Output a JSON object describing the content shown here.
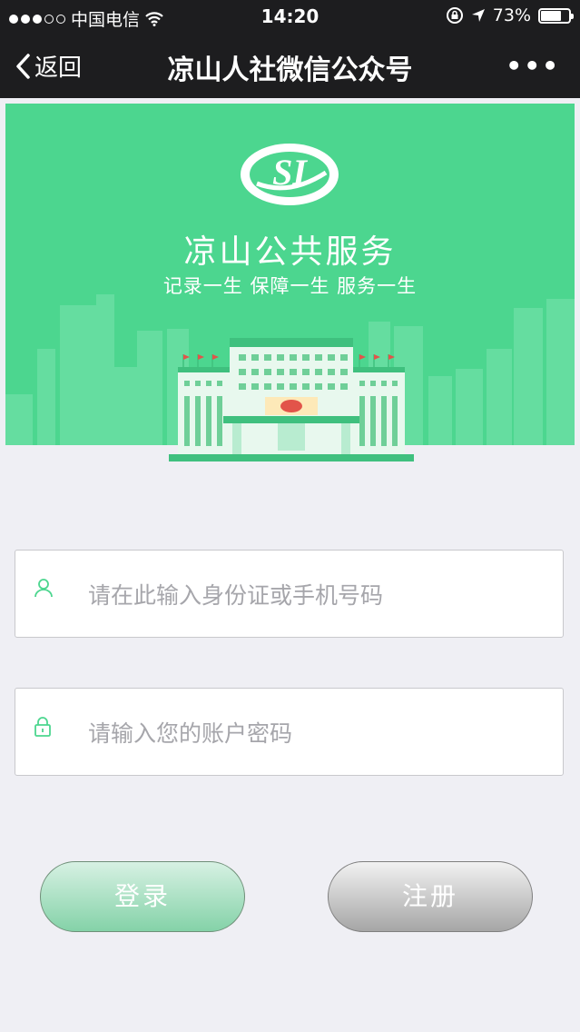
{
  "status_bar": {
    "carrier": "中国电信",
    "time": "14:20",
    "battery": "73%",
    "battery_level": 0.73
  },
  "nav": {
    "back_label": "返回",
    "title": "凉山人社微信公众号",
    "more_label": "•••"
  },
  "banner": {
    "logo_text": "SI",
    "title": "凉山公共服务",
    "subtitle": "记录一生  保障一生  服务一生",
    "accent": "#4cd68f"
  },
  "form": {
    "id_placeholder": "请在此输入身份证或手机号码",
    "id_value": "",
    "password_placeholder": "请输入您的账户密码",
    "password_value": ""
  },
  "buttons": {
    "login": "登录",
    "register": "注册"
  }
}
